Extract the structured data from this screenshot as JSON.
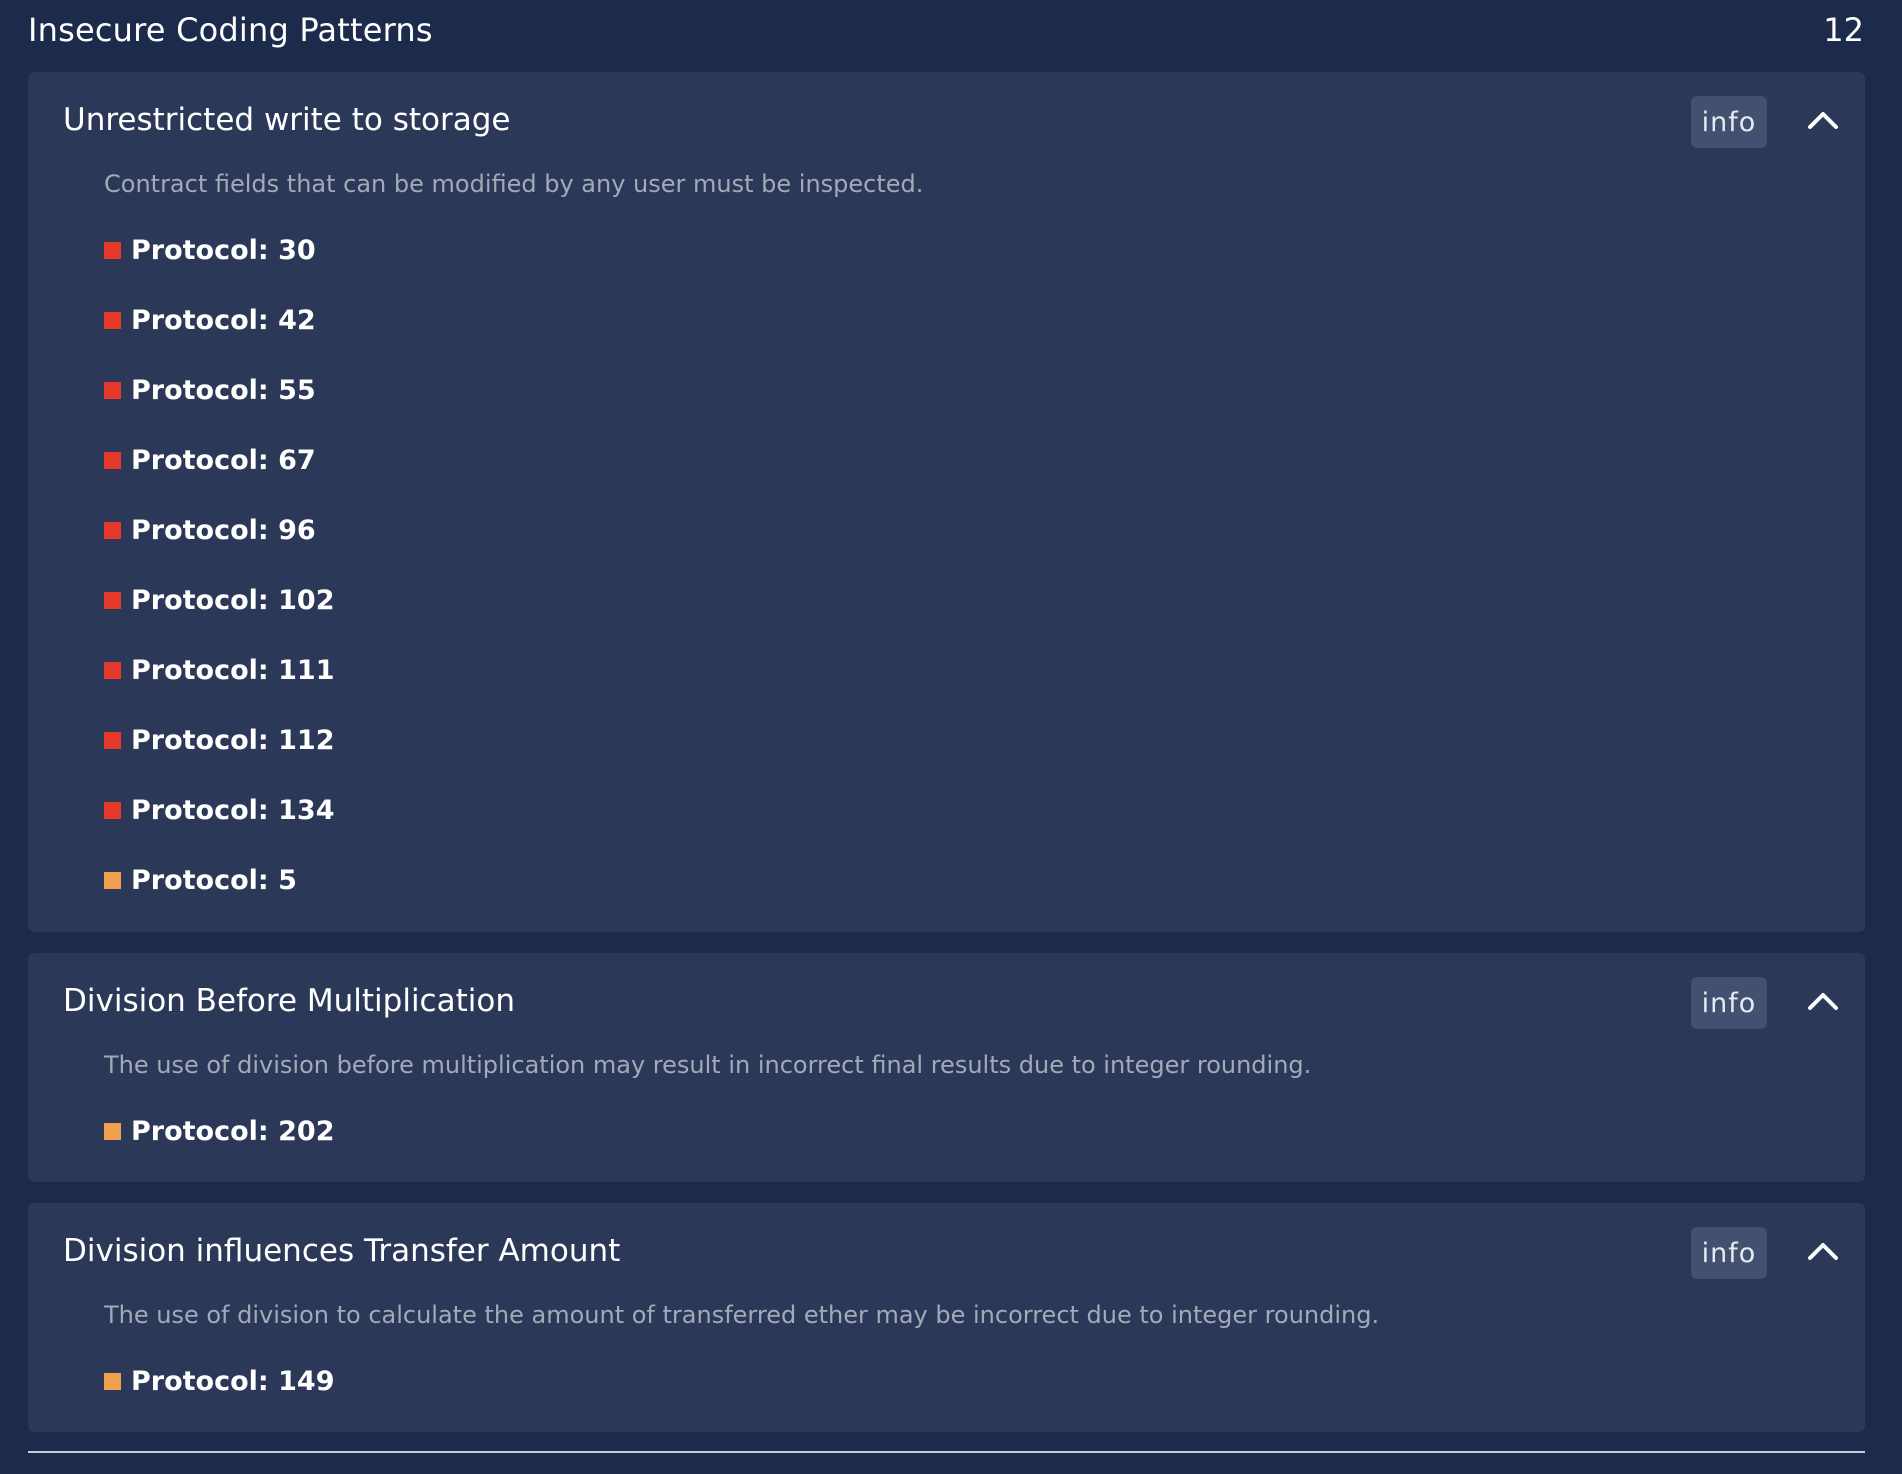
{
  "header": {
    "title": "Insecure Coding Patterns",
    "count": "12"
  },
  "colors": {
    "background": "#1c2a4b",
    "card": "#2c3858",
    "severity_high": "#e5392b",
    "severity_medium": "#f0a150"
  },
  "icons": {
    "collapse": "chevron-up-icon"
  },
  "cards": [
    {
      "title": "Unrestricted write to storage",
      "info_label": "info",
      "description": "Contract fields that can be modified by any user must be inspected.",
      "items": [
        {
          "label": "Protocol: 30",
          "severity": "high"
        },
        {
          "label": "Protocol: 42",
          "severity": "high"
        },
        {
          "label": "Protocol: 55",
          "severity": "high"
        },
        {
          "label": "Protocol: 67",
          "severity": "high"
        },
        {
          "label": "Protocol: 96",
          "severity": "high"
        },
        {
          "label": "Protocol: 102",
          "severity": "high"
        },
        {
          "label": "Protocol: 111",
          "severity": "high"
        },
        {
          "label": "Protocol: 112",
          "severity": "high"
        },
        {
          "label": "Protocol: 134",
          "severity": "high"
        },
        {
          "label": "Protocol: 5",
          "severity": "medium"
        }
      ]
    },
    {
      "title": "Division Before Multiplication",
      "info_label": "info",
      "description": "The use of division before multiplication may result in incorrect final results due to integer rounding.",
      "items": [
        {
          "label": "Protocol: 202",
          "severity": "medium"
        }
      ]
    },
    {
      "title": "Division influences Transfer Amount",
      "info_label": "info",
      "description": "The use of division to calculate the amount of transferred ether may be incorrect due to integer rounding.",
      "items": [
        {
          "label": "Protocol: 149",
          "severity": "medium"
        }
      ]
    }
  ]
}
